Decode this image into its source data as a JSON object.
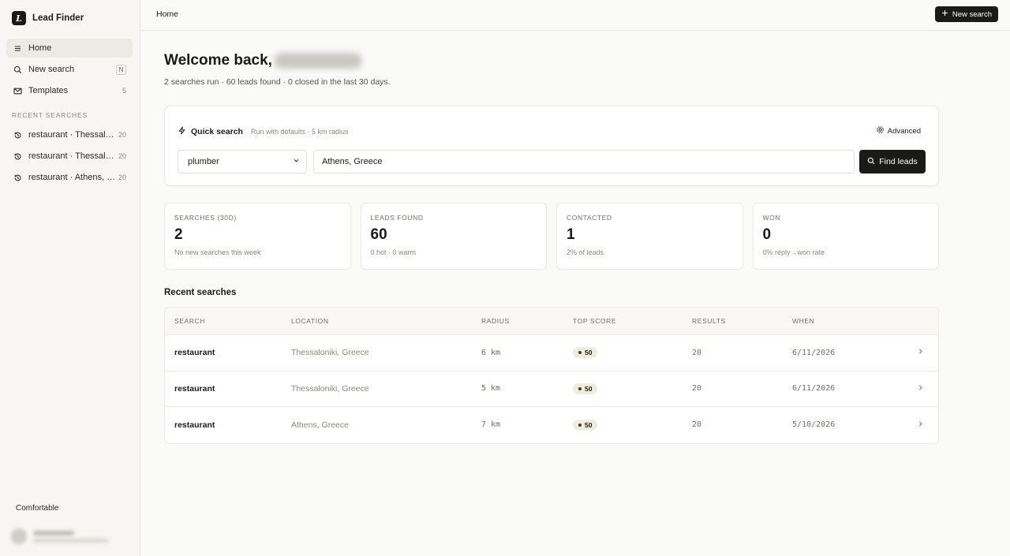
{
  "app": {
    "name": "Lead Finder",
    "logo_letter": "L"
  },
  "sidebar": {
    "items": [
      {
        "label": "Home",
        "icon": "menu-icon",
        "meta": ""
      },
      {
        "label": "New search",
        "icon": "search-icon",
        "meta": "N"
      },
      {
        "label": "Templates",
        "icon": "mail-icon",
        "meta": "5"
      }
    ],
    "recent_label": "RECENT SEARCHES",
    "recent": [
      {
        "label": "restaurant · Thessaloniki, Greece",
        "count": "20"
      },
      {
        "label": "restaurant · Thessaloniki, Greece",
        "count": "20"
      },
      {
        "label": "restaurant · Athens, Greece",
        "count": "20"
      }
    ],
    "density": "Comfortable"
  },
  "topbar": {
    "breadcrumb": "Home",
    "new_search_label": "New search"
  },
  "main": {
    "welcome": "Welcome back,",
    "subline": "2 searches run · 60 leads found · 0 closed in the last 30 days."
  },
  "quick_search": {
    "title": "Quick search",
    "note": "Run with defaults · 5 km radius",
    "advanced_label": "Advanced",
    "category_value": "plumber",
    "location_value": "Athens, Greece",
    "find_label": "Find leads"
  },
  "stats": [
    {
      "label": "SEARCHES (30D)",
      "value": "2",
      "note": "No new searches this week"
    },
    {
      "label": "LEADS FOUND",
      "value": "60",
      "note": "0 hot · 0 warm"
    },
    {
      "label": "CONTACTED",
      "value": "1",
      "note": "2% of leads"
    },
    {
      "label": "WON",
      "value": "0",
      "note": "0% reply→won rate"
    }
  ],
  "recent_searches": {
    "title": "Recent searches",
    "columns": [
      "SEARCH",
      "LOCATION",
      "RADIUS",
      "TOP SCORE",
      "RESULTS",
      "WHEN"
    ],
    "rows": [
      {
        "search": "restaurant",
        "location": "Thessaloniki, Greece",
        "radius": "6 km",
        "score": "50",
        "results": "20",
        "when": "6/11/2026"
      },
      {
        "search": "restaurant",
        "location": "Thessaloniki, Greece",
        "radius": "5 km",
        "score": "50",
        "results": "20",
        "when": "6/11/2026"
      },
      {
        "search": "restaurant",
        "location": "Athens, Greece",
        "radius": "7 km",
        "score": "50",
        "results": "20",
        "when": "5/10/2026"
      }
    ]
  }
}
